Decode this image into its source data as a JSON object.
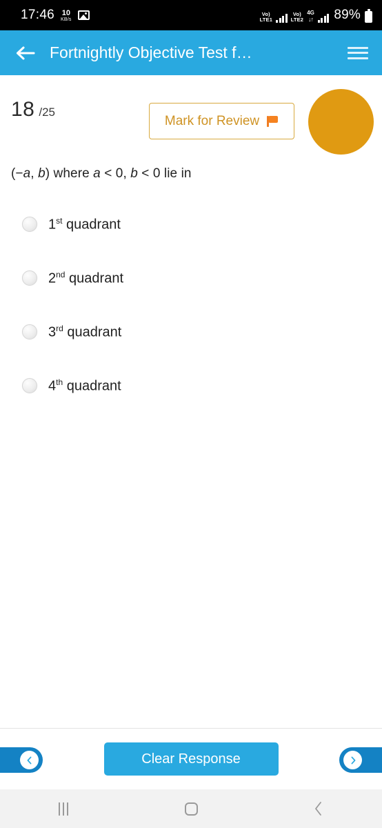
{
  "status_bar": {
    "time": "17:46",
    "data_rate_value": "10",
    "data_rate_unit": "KB/s",
    "photo_icon": "photo-icon",
    "sim1_volte": "Vo)",
    "sim1_label": "LTE1",
    "sim2_volte": "Vo)",
    "sim2_label": "LTE2",
    "network_type": "4G",
    "data_arrows": "↓↑",
    "battery_percent": "89%"
  },
  "header": {
    "back_icon": "back-arrow-icon",
    "title": "Fortnightly Objective Test f…",
    "menu_icon": "hamburger-menu-icon",
    "background_color": "#29a9e0"
  },
  "question_meta": {
    "current_number": "18",
    "total_label": "/25",
    "mark_for_review_label": "Mark for Review",
    "flag_icon": "flag-icon",
    "flag_color": "#f58220",
    "mark_border_color": "#d8a93f",
    "mark_text_color": "#cf9324",
    "avatar_color": "#e09a12"
  },
  "question": {
    "prefix": "(−",
    "var_a": "a",
    "mid1": ", ",
    "var_b": "b",
    "mid2": ") where ",
    "var_a2": "a",
    "mid3": " < 0, ",
    "var_b2": "b",
    "suffix": " < 0 lie in",
    "full_text": "(−a, b) where a < 0, b < 0 lie in"
  },
  "options": [
    {
      "ordinal": "1",
      "superscript": "st",
      "label": "quadrant",
      "selected": false
    },
    {
      "ordinal": "2",
      "superscript": "nd",
      "label": "quadrant",
      "selected": false
    },
    {
      "ordinal": "3",
      "superscript": "rd",
      "label": "quadrant",
      "selected": false
    },
    {
      "ordinal": "4",
      "superscript": "th",
      "label": "quadrant",
      "selected": false
    }
  ],
  "action_bar": {
    "prev_icon": "chevron-left-icon",
    "clear_response_label": "Clear Response",
    "next_icon": "chevron-right-icon",
    "clear_button_color": "#29a9e0",
    "nav_pill_color": "#1482c4"
  },
  "android_nav": {
    "recents_icon": "recents-icon",
    "home_icon": "home-icon",
    "back_icon": "back-icon"
  }
}
